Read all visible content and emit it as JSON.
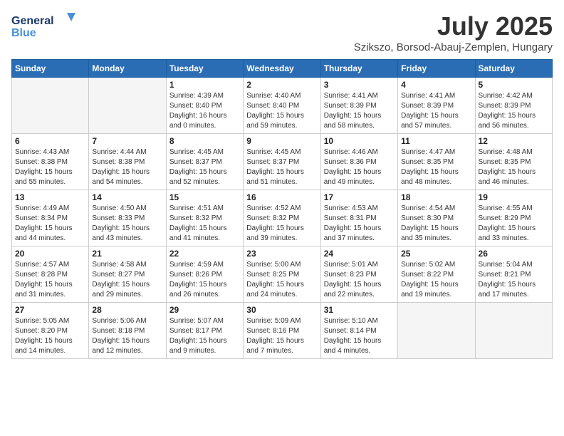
{
  "logo": {
    "line1": "General",
    "line2": "Blue"
  },
  "title": "July 2025",
  "location": "Szikszo, Borsod-Abauj-Zemplen, Hungary",
  "weekdays": [
    "Sunday",
    "Monday",
    "Tuesday",
    "Wednesday",
    "Thursday",
    "Friday",
    "Saturday"
  ],
  "weeks": [
    [
      {
        "day": "",
        "empty": true
      },
      {
        "day": "",
        "empty": true
      },
      {
        "day": "1",
        "sunrise": "4:39 AM",
        "sunset": "8:40 PM",
        "daylight": "16 hours and 0 minutes."
      },
      {
        "day": "2",
        "sunrise": "4:40 AM",
        "sunset": "8:40 PM",
        "daylight": "15 hours and 59 minutes."
      },
      {
        "day": "3",
        "sunrise": "4:41 AM",
        "sunset": "8:39 PM",
        "daylight": "15 hours and 58 minutes."
      },
      {
        "day": "4",
        "sunrise": "4:41 AM",
        "sunset": "8:39 PM",
        "daylight": "15 hours and 57 minutes."
      },
      {
        "day": "5",
        "sunrise": "4:42 AM",
        "sunset": "8:39 PM",
        "daylight": "15 hours and 56 minutes."
      }
    ],
    [
      {
        "day": "6",
        "sunrise": "4:43 AM",
        "sunset": "8:38 PM",
        "daylight": "15 hours and 55 minutes."
      },
      {
        "day": "7",
        "sunrise": "4:44 AM",
        "sunset": "8:38 PM",
        "daylight": "15 hours and 54 minutes."
      },
      {
        "day": "8",
        "sunrise": "4:45 AM",
        "sunset": "8:37 PM",
        "daylight": "15 hours and 52 minutes."
      },
      {
        "day": "9",
        "sunrise": "4:45 AM",
        "sunset": "8:37 PM",
        "daylight": "15 hours and 51 minutes."
      },
      {
        "day": "10",
        "sunrise": "4:46 AM",
        "sunset": "8:36 PM",
        "daylight": "15 hours and 49 minutes."
      },
      {
        "day": "11",
        "sunrise": "4:47 AM",
        "sunset": "8:35 PM",
        "daylight": "15 hours and 48 minutes."
      },
      {
        "day": "12",
        "sunrise": "4:48 AM",
        "sunset": "8:35 PM",
        "daylight": "15 hours and 46 minutes."
      }
    ],
    [
      {
        "day": "13",
        "sunrise": "4:49 AM",
        "sunset": "8:34 PM",
        "daylight": "15 hours and 44 minutes."
      },
      {
        "day": "14",
        "sunrise": "4:50 AM",
        "sunset": "8:33 PM",
        "daylight": "15 hours and 43 minutes."
      },
      {
        "day": "15",
        "sunrise": "4:51 AM",
        "sunset": "8:32 PM",
        "daylight": "15 hours and 41 minutes."
      },
      {
        "day": "16",
        "sunrise": "4:52 AM",
        "sunset": "8:32 PM",
        "daylight": "15 hours and 39 minutes."
      },
      {
        "day": "17",
        "sunrise": "4:53 AM",
        "sunset": "8:31 PM",
        "daylight": "15 hours and 37 minutes."
      },
      {
        "day": "18",
        "sunrise": "4:54 AM",
        "sunset": "8:30 PM",
        "daylight": "15 hours and 35 minutes."
      },
      {
        "day": "19",
        "sunrise": "4:55 AM",
        "sunset": "8:29 PM",
        "daylight": "15 hours and 33 minutes."
      }
    ],
    [
      {
        "day": "20",
        "sunrise": "4:57 AM",
        "sunset": "8:28 PM",
        "daylight": "15 hours and 31 minutes."
      },
      {
        "day": "21",
        "sunrise": "4:58 AM",
        "sunset": "8:27 PM",
        "daylight": "15 hours and 29 minutes."
      },
      {
        "day": "22",
        "sunrise": "4:59 AM",
        "sunset": "8:26 PM",
        "daylight": "15 hours and 26 minutes."
      },
      {
        "day": "23",
        "sunrise": "5:00 AM",
        "sunset": "8:25 PM",
        "daylight": "15 hours and 24 minutes."
      },
      {
        "day": "24",
        "sunrise": "5:01 AM",
        "sunset": "8:23 PM",
        "daylight": "15 hours and 22 minutes."
      },
      {
        "day": "25",
        "sunrise": "5:02 AM",
        "sunset": "8:22 PM",
        "daylight": "15 hours and 19 minutes."
      },
      {
        "day": "26",
        "sunrise": "5:04 AM",
        "sunset": "8:21 PM",
        "daylight": "15 hours and 17 minutes."
      }
    ],
    [
      {
        "day": "27",
        "sunrise": "5:05 AM",
        "sunset": "8:20 PM",
        "daylight": "15 hours and 14 minutes."
      },
      {
        "day": "28",
        "sunrise": "5:06 AM",
        "sunset": "8:18 PM",
        "daylight": "15 hours and 12 minutes."
      },
      {
        "day": "29",
        "sunrise": "5:07 AM",
        "sunset": "8:17 PM",
        "daylight": "15 hours and 9 minutes."
      },
      {
        "day": "30",
        "sunrise": "5:09 AM",
        "sunset": "8:16 PM",
        "daylight": "15 hours and 7 minutes."
      },
      {
        "day": "31",
        "sunrise": "5:10 AM",
        "sunset": "8:14 PM",
        "daylight": "15 hours and 4 minutes."
      },
      {
        "day": "",
        "empty": true
      },
      {
        "day": "",
        "empty": true
      }
    ]
  ]
}
